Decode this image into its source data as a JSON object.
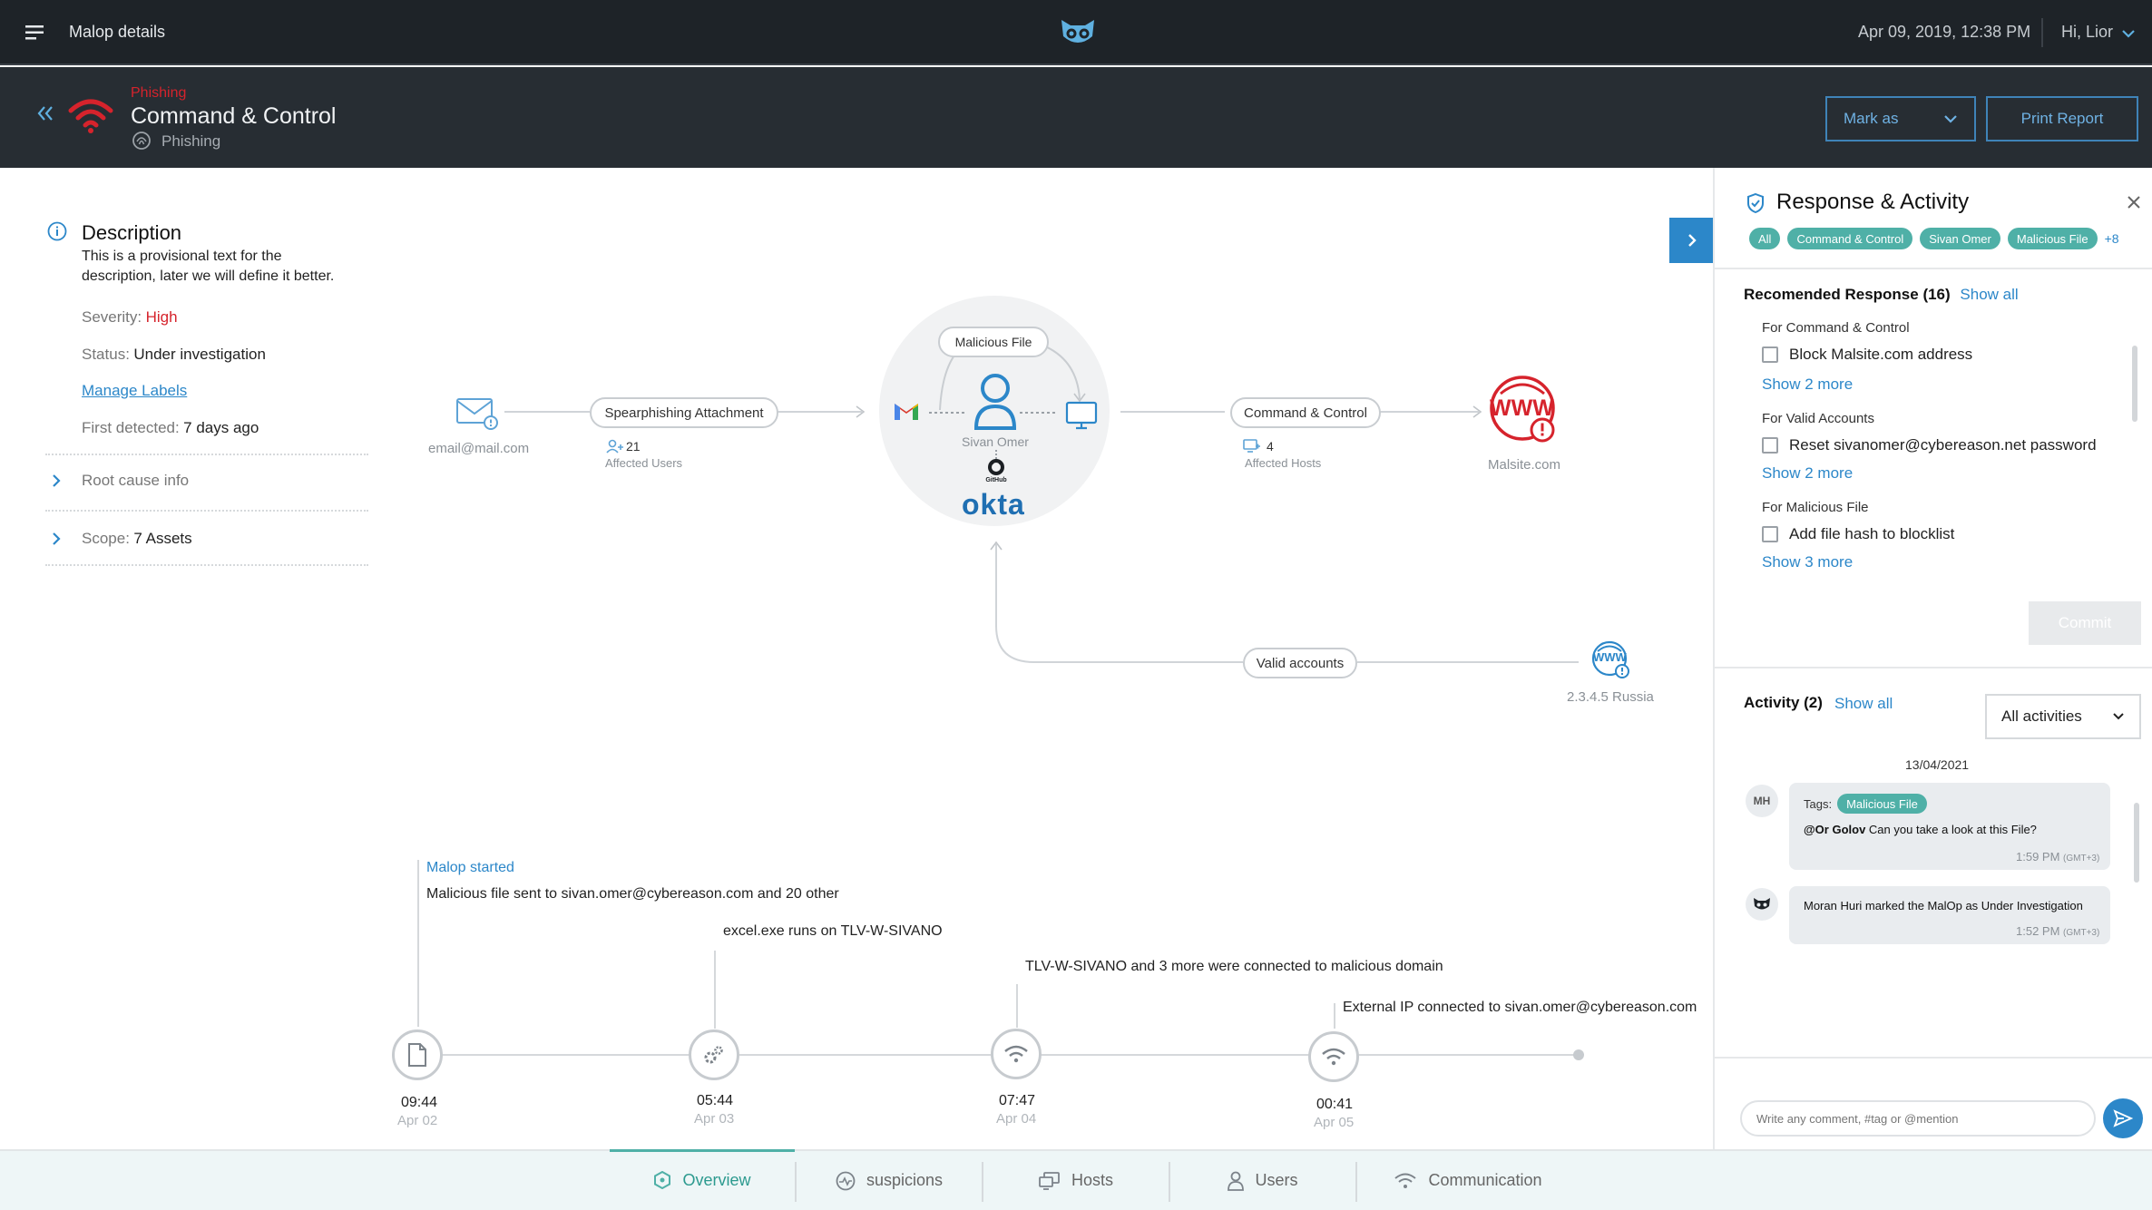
{
  "topbar": {
    "title": "Malop details",
    "datetime": "Apr 09, 2019, 12:38 PM",
    "greeting": "Hi, Lior"
  },
  "malop": {
    "category": "Phishing",
    "title": "Command & Control",
    "subtitle": "Phishing",
    "mark_as": "Mark as",
    "print": "Print Report"
  },
  "description": {
    "heading": "Description",
    "text_line1": "This is a provisional text for the",
    "text_line2": "description, later we will define it better.",
    "severity_label": "Severity:",
    "severity_value": "High",
    "status_label": "Status:",
    "status_value": "Under investigation",
    "manage_labels": "Manage Labels",
    "first_detected_label": "First detected:",
    "first_detected_value": "7 days ago",
    "root_cause": "Root cause info",
    "scope_label": "Scope:",
    "scope_value": "7 Assets"
  },
  "graph": {
    "email": "email@mail.com",
    "spearphishing": "Spearphishing Attachment",
    "affected_users_count": "21",
    "affected_users_label": "Affected Users",
    "malicious_file": "Malicious File",
    "user_name": "Sivan Omer",
    "github_label": "GitHub",
    "okta": "okta",
    "command_control": "Command & Control",
    "affected_hosts_count": "4",
    "affected_hosts_label": "Affected Hosts",
    "www": "WWW",
    "malsite": "Malsite.com",
    "valid_accounts": "Valid accounts",
    "ip": "2.3.4.5 Russia"
  },
  "timeline": {
    "malop_started": "Malop started",
    "event1": "Malicious file sent to sivan.omer@cybereason.com and 20 other",
    "event2": "excel.exe runs on TLV-W-SIVANO",
    "event3": "TLV-W-SIVANO and 3 more were connected to malicious domain",
    "event4": "External IP connected to sivan.omer@cybereason.com",
    "points": [
      {
        "time": "09:44",
        "date": "Apr 02"
      },
      {
        "time": "05:44",
        "date": "Apr 03"
      },
      {
        "time": "07:47",
        "date": "Apr 04"
      },
      {
        "time": "00:41",
        "date": "Apr 05"
      }
    ]
  },
  "panel": {
    "title": "Response & Activity",
    "chips": [
      "All",
      "Command & Control",
      "Sivan Omer",
      "Malicious File"
    ],
    "more_chips": "+8",
    "recommended": "Recomended Response (16)",
    "show_all": "Show all",
    "groups": [
      {
        "title": "For Command & Control",
        "item": "Block Malsite.com address",
        "more": "Show 2 more"
      },
      {
        "title": "For Valid Accounts",
        "item": "Reset sivanomer@cybereason.net password",
        "more": "Show 2 more"
      },
      {
        "title": "For Malicious File",
        "item": "Add file hash to blocklist",
        "more": "Show 3 more"
      }
    ],
    "commit": "Commit",
    "activity": "Activity (2)",
    "activity_show_all": "Show all",
    "activity_filter": "All activities",
    "date": "13/04/2021",
    "msg1_avatar": "MH",
    "msg1_tags_label": "Tags:",
    "msg1_tag": "Malicious File",
    "msg1_mention": "@Or Golov",
    "msg1_text": "Can you take a look at this File?",
    "msg1_time": "1:59 PM",
    "msg1_tz": "(GMT+3)",
    "msg2_text": "Moran Huri marked the MalOp as Under Investigation",
    "msg2_time": "1:52 PM",
    "msg2_tz": "(GMT+3)",
    "comment_placeholder": "Write any comment, #tag or @mention"
  },
  "tabs": [
    "Overview",
    "suspicions",
    "Hosts",
    "Users",
    "Communication"
  ],
  "colors": {
    "topbar": "#1e2328",
    "header": "#272d33",
    "accent": "#2c87c9",
    "danger": "#d6232c",
    "chip": "#4fb0a7",
    "okta": "#1f6fb2"
  }
}
